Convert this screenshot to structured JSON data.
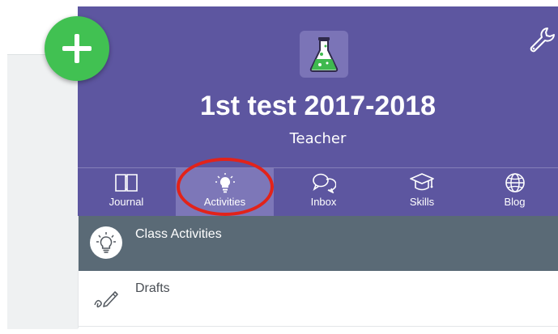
{
  "colors": {
    "header_purple": "#5d56a0",
    "active_tab": "#7d77b8",
    "fab_green": "#41c152",
    "annotation_red": "#e2231a",
    "active_row": "#5a6a76"
  },
  "fab": {
    "icon": "plus-icon"
  },
  "header": {
    "class_icon": "flask-icon",
    "title": "1st test 2017-2018",
    "role": "Teacher",
    "settings_icon": "wrench-icon"
  },
  "tabs": [
    {
      "label": "Journal",
      "icon": "book-icon",
      "active": false
    },
    {
      "label": "Activities",
      "icon": "lightbulb-icon",
      "active": true
    },
    {
      "label": "Inbox",
      "icon": "chat-bubbles-icon",
      "active": false
    },
    {
      "label": "Skills",
      "icon": "graduation-cap-icon",
      "active": false
    },
    {
      "label": "Blog",
      "icon": "globe-icon",
      "active": false
    }
  ],
  "list": {
    "items": [
      {
        "label": "Class Activities",
        "icon": "lightbulb-icon",
        "selected": true
      },
      {
        "label": "Drafts",
        "icon": "pencil-icon",
        "selected": false
      }
    ]
  }
}
